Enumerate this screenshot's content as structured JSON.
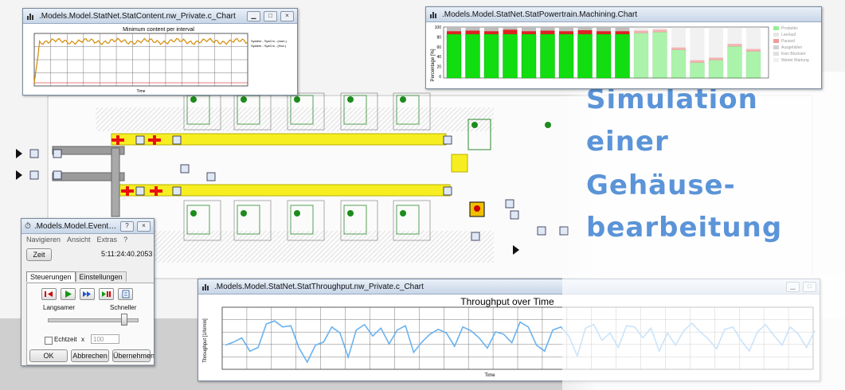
{
  "headline": {
    "lines": [
      "Simulation",
      "einer",
      "Gehäuse-",
      "bearbeitung"
    ]
  },
  "colors": {
    "headline": "#5b94d8",
    "conveyor": "#f7ee22",
    "blocked": "#e81212",
    "machine_on": "#1c8c1c",
    "chart_line_orange": "#d38a00",
    "chart_line_blue": "#6ab2ef",
    "bar_green": "#11dd11",
    "bar_red": "#dd2222"
  },
  "content_chart": {
    "window_title": ".Models.Model.StatNet.StatContent.nw_Private.c_Chart",
    "plot_title": "Minimum content per interval",
    "xlabel": "Time",
    "legend": [
      "System - SysCm - (num.)",
      "System - SysCm - (Hoz.)"
    ],
    "icons": [
      "chart-icon",
      "minimize-icon",
      "maximize-icon",
      "close-icon"
    ]
  },
  "powertrain_chart": {
    "window_title": ".Models.Model.StatNet.StatPowertrain.Machining.Chart",
    "ylabel": "Percentage [%]",
    "yticks": [
      "100",
      "80",
      "60",
      "40",
      "20",
      "0"
    ],
    "legend": [
      "Produktiv",
      "Leerlauf",
      "Paused",
      "Ausgefallen",
      "Kein Blockiert",
      "Wartet Wartung"
    ]
  },
  "throughput_chart": {
    "window_title": ".Models.Model.StatNet.StatThroughput.nw_Private.c_Chart",
    "plot_title": "Throughput over Time",
    "xlabel": "Time",
    "ylabel": "Throughput [1/h/min]"
  },
  "event_controller": {
    "window_title": ".Models.Model.EventController",
    "title_buttons": [
      "?",
      "×"
    ],
    "menu": [
      "Navigieren",
      "Ansicht",
      "Extras",
      "?"
    ],
    "time_button": "Zeit",
    "time_value": "5:11:24:40.2053",
    "tabs": [
      "Steuerungen",
      "Einstellungen"
    ],
    "playback_icons": [
      "reset-icon",
      "play-icon",
      "fast-forward-icon",
      "step-icon",
      "list-icon"
    ],
    "speed_slow": "Langsamer",
    "speed_fast": "Schneller",
    "speed_level": 0.85,
    "realtime_label": "Echtzeit",
    "realtime_checked": false,
    "realtime_factor_label": "x",
    "realtime_factor": "100",
    "buttons": {
      "ok": "OK",
      "cancel": "Abbrechen",
      "apply": "Übernehmen"
    }
  }
}
